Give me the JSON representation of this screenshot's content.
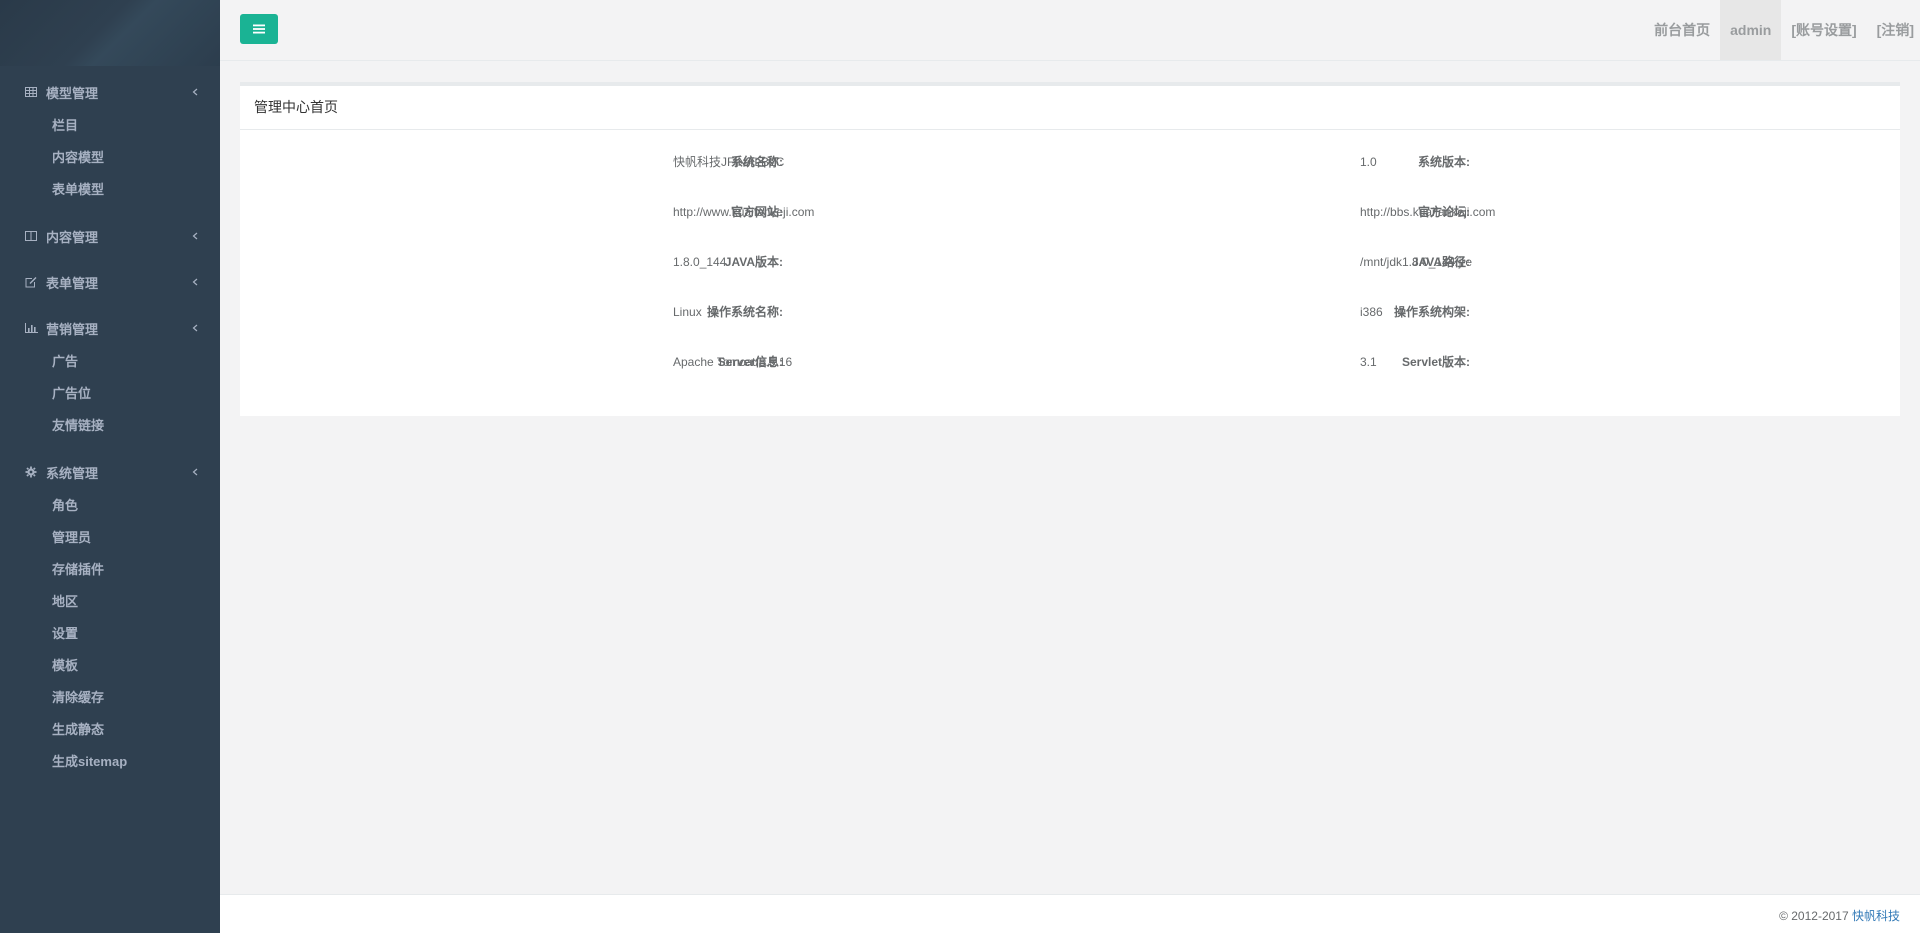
{
  "sidebar": {
    "groups": [
      {
        "label": "模型管理",
        "icon": "table-icon",
        "items": [
          "栏目",
          "内容模型",
          "表单模型"
        ]
      },
      {
        "label": "内容管理",
        "icon": "columns-icon",
        "items": []
      },
      {
        "label": "表单管理",
        "icon": "edit-icon",
        "items": []
      },
      {
        "label": "营销管理",
        "icon": "bar-chart-icon",
        "items": [
          "广告",
          "广告位",
          "友情链接"
        ]
      },
      {
        "label": "系统管理",
        "icon": "gear-icon",
        "items": [
          "角色",
          "管理员",
          "存储插件",
          "地区",
          "设置",
          "模板",
          "清除缓存",
          "生成静态",
          "生成sitemap"
        ]
      }
    ]
  },
  "topbar": {
    "menu_toggle_icon": "hamburger-icon",
    "links": [
      "前台首页",
      "admin",
      "[账号设置]",
      "[注销]"
    ]
  },
  "panel": {
    "title": "管理中心首页",
    "rows": [
      {
        "left_label": "系统名称:",
        "left_value": "快帆科技JFINALB2C",
        "right_label": "系统版本:",
        "right_value": "1.0"
      },
      {
        "left_label": "官方网站:",
        "left_value": "http://www.kuaifankeji.com",
        "right_label": "官方论坛:",
        "right_value": "http://bbs.kuaifankeji.com"
      },
      {
        "left_label": "JAVA版本:",
        "left_value": "1.8.0_144",
        "right_label": "JAVA路径:",
        "right_value": "/mnt/jdk1.8.0_144/jre"
      },
      {
        "left_label": "操作系统名称:",
        "left_value": "Linux",
        "right_label": "操作系统构架:",
        "right_value": "i386"
      },
      {
        "left_label": "Server信息:",
        "left_value": "Apache Tomcat/8.5.16",
        "right_label": "Servlet版本:",
        "right_value": "3.1"
      }
    ]
  },
  "footer": {
    "copyright": "© 2012-2017 ",
    "company": "快帆科技"
  },
  "colors": {
    "sidebar_bg": "#2f4050",
    "accent": "#1ab394",
    "link": "#337ab7"
  }
}
